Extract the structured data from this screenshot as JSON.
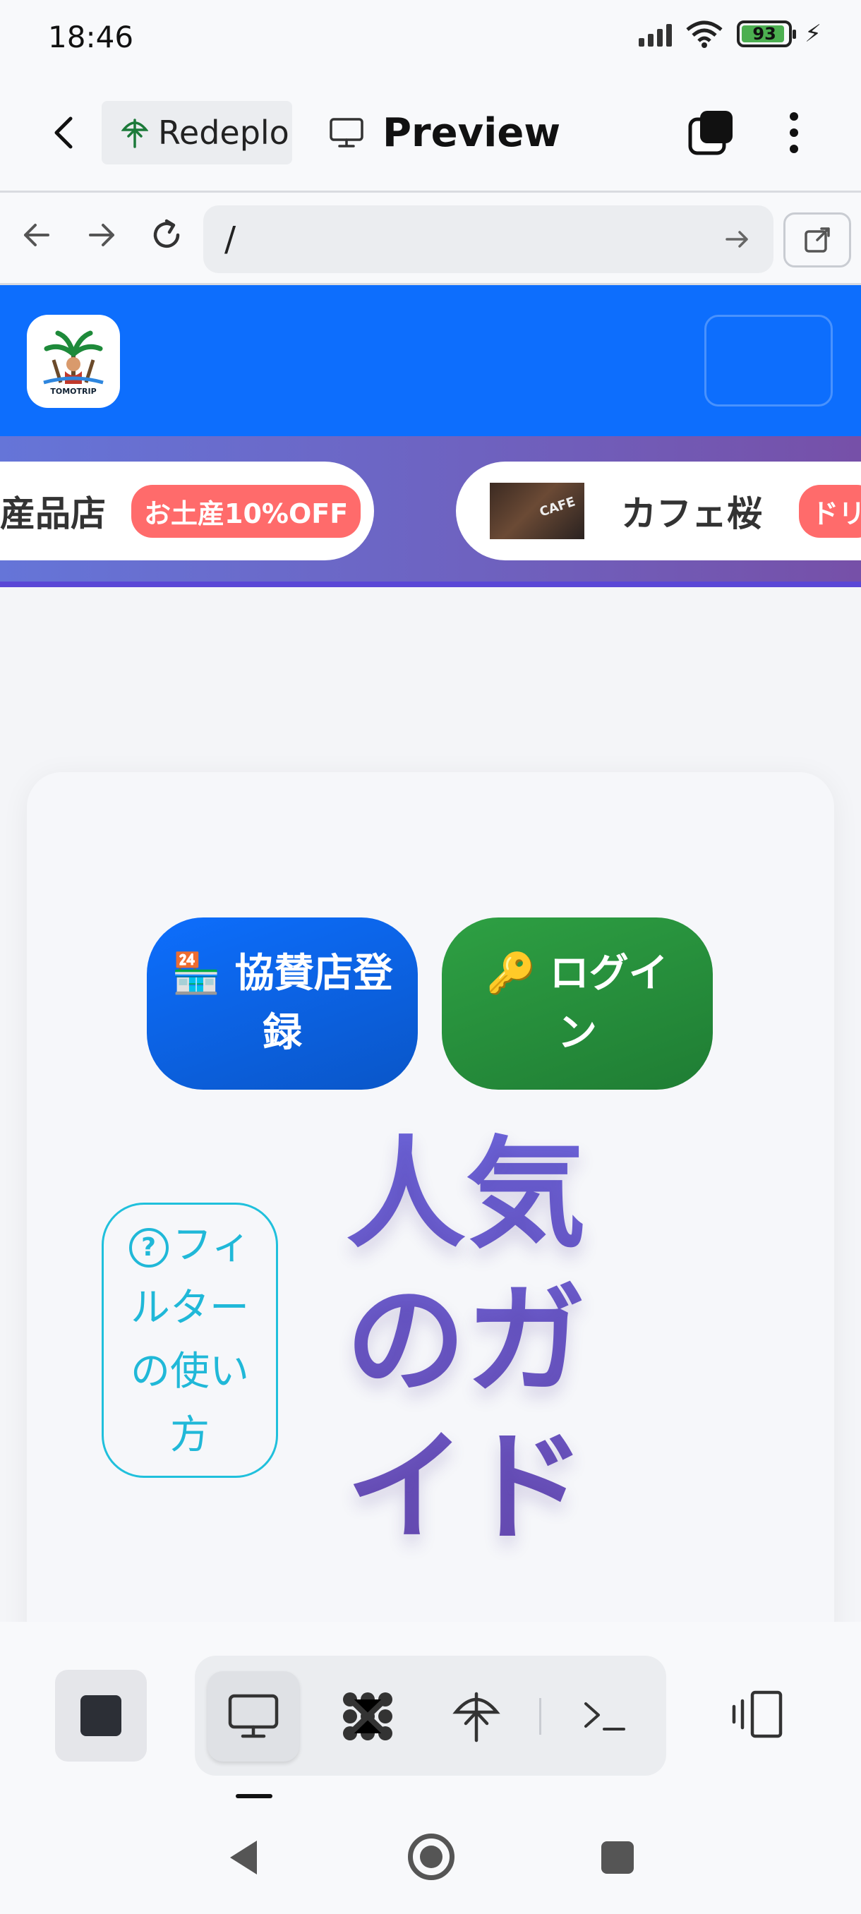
{
  "status_bar": {
    "time": "18:46",
    "battery": "93"
  },
  "app_bar": {
    "repl_tab_label": "Redeplo",
    "preview_tab_label": "Preview"
  },
  "url_bar": {
    "value": "/"
  },
  "site": {
    "logo_text": "TOMOTRIP",
    "ticker": [
      {
        "name": "産品店",
        "badge": "お土産10%OFF"
      },
      {
        "name": "カフェ桜",
        "badge": "ドリ",
        "thumb_text": "CAFE"
      }
    ],
    "buttons": {
      "register": "🏪 協賛店登録",
      "login": "🔑 ログイン",
      "help_icon": "?",
      "help": "フィルターの使い方"
    },
    "heading": "人気のガイド"
  },
  "colors": {
    "header_blue": "#0d6efd",
    "login_green": "#2ea043",
    "help_cyan": "#20b8d8",
    "heading_purple": "#6a5fcf",
    "badge_red": "#ff6b6b"
  }
}
